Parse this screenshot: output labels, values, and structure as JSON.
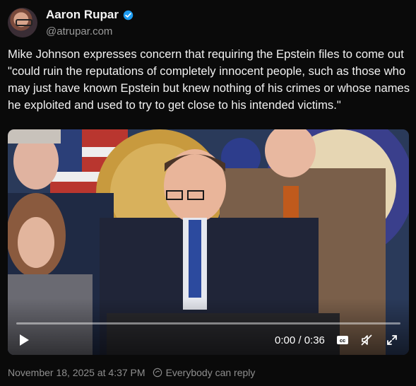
{
  "author": {
    "name": "Aaron Rupar",
    "handle": "@atrupar.com",
    "verified_color": "#1d9bf0"
  },
  "post": {
    "text": "Mike Johnson expresses concern that requiring the Epstein files to come out \"could ruin the reputations of completely innocent people, such as those who may just have known Epstein but knew nothing of his crimes or whose names he exploited and used to try to get close to his intended victims.\""
  },
  "video": {
    "time_display": "0:00 / 0:36",
    "progress": 0,
    "controls": [
      "play-icon",
      "captions-icon",
      "mute-icon",
      "fullscreen-icon"
    ],
    "captions_label": "cc"
  },
  "footer": {
    "timestamp": "November 18, 2025 at 4:37 PM",
    "reply_setting": "Everybody can reply"
  }
}
